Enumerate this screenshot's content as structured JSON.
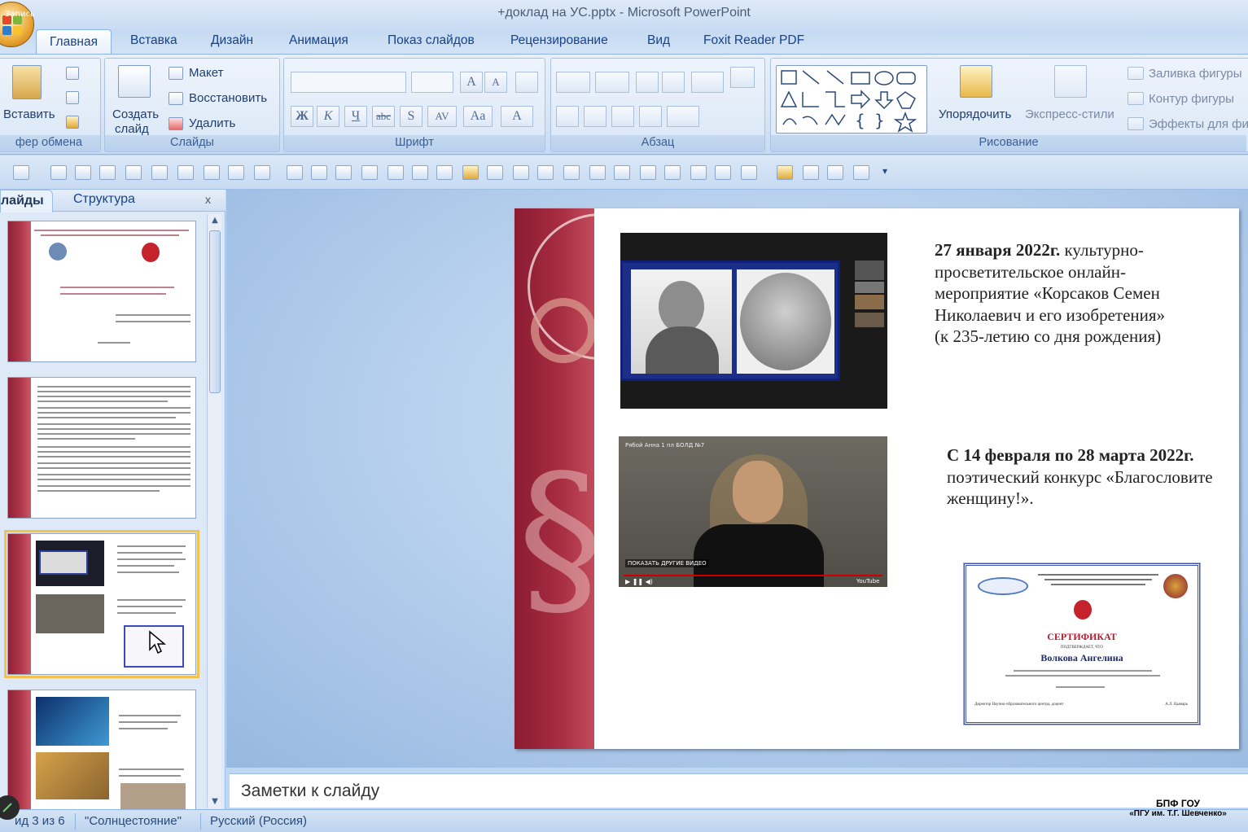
{
  "window": {
    "title": "+доклад на УС.pptx - Microsoft PowerPoint",
    "record_label": "Запись"
  },
  "tabs": [
    "Главная",
    "Вставка",
    "Дизайн",
    "Анимация",
    "Показ слайдов",
    "Рецензирование",
    "Вид",
    "Foxit Reader PDF"
  ],
  "ribbon": {
    "clipboard": {
      "paste": "Вставить",
      "label": "фер обмена"
    },
    "slides": {
      "create_line1": "Создать",
      "create_line2": "слайд",
      "layout": "Макет",
      "reset": "Восстановить",
      "delete": "Удалить",
      "label": "Слайды"
    },
    "font": {
      "label": "Шрифт",
      "bold": "Ж",
      "italic": "К",
      "underline": "Ч",
      "strike": "abc",
      "shadow": "S",
      "spacing": "AV",
      "case": "Aa",
      "color": "A"
    },
    "paragraph": {
      "label": "Абзац"
    },
    "drawing": {
      "label": "Рисование",
      "arrange": "Упорядочить",
      "styles": "Экспресс-стили",
      "fill": "Заливка фигуры",
      "outline": "Контур фигуры",
      "effects": "Эффекты для фи"
    }
  },
  "left_pane": {
    "tab_slides": "лайды",
    "tab_outline": "Структура",
    "close": "x"
  },
  "slide": {
    "event1": {
      "date": "27 января 2022г.",
      "text_rest": " культурно-просветительское онлайн-мероприятие «Корсаков Семен Николаевич и его изобретения»",
      "anniversary": "(к 235-летию со дня рождения)"
    },
    "event2": {
      "date": "С 14 февраля по 28 марта 2022г.",
      "text": "поэтический конкурс «Благословите женщину!»."
    },
    "video": {
      "title": "Рябой Анна 1 пл БОЛД №7",
      "show_more": "ПОКАЗАТЬ ДРУГИЕ ВИДЕО",
      "brand": "YouTube"
    },
    "certificate": {
      "heading": "СЕРТИФИКАТ",
      "subheading": "подтверждает, что",
      "name": "Волкова Ангелина",
      "footer_left": "Директор Научно-образовательного центра, доцент",
      "footer_right": "А.Л. Цымарь"
    }
  },
  "notes": {
    "placeholder": "Заметки к слайду"
  },
  "status": {
    "slide": "ид 3 из 6",
    "theme": "\"Солнцестояние\"",
    "language": "Русский (Россия)"
  },
  "watermark": {
    "line1": "БПФ ГОУ",
    "line2": "«ПГУ им. Т.Г. Шевченко»"
  },
  "colors": {
    "accent": "#15428b",
    "slide_band": "#a62c41",
    "selection": "#f2c14e"
  }
}
